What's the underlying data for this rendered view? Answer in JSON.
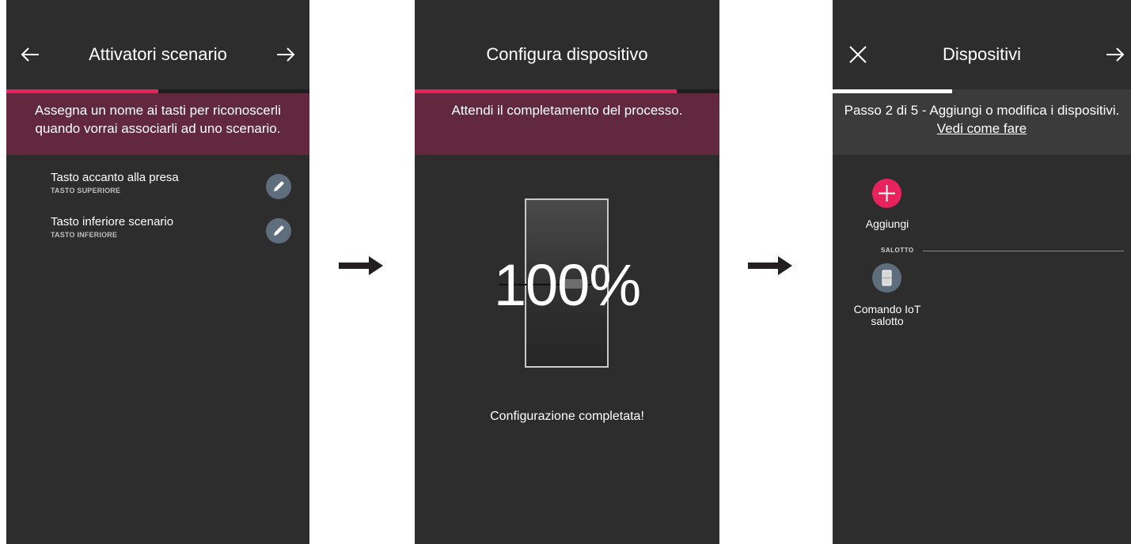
{
  "screen1": {
    "title": "Attivatori scenario",
    "progress_percent": 50,
    "banner": "Assegna un nome ai tasti per riconoscerli quando vorrai associarli ad uno scenario.",
    "buttons": [
      {
        "name": "Tasto accanto alla presa",
        "position": "TASTO SUPERIORE",
        "icon": "pencil-icon"
      },
      {
        "name": "Tasto inferiore scenario",
        "position": "TASTO INFERIORE",
        "icon": "pencil-icon"
      }
    ],
    "icons": {
      "back": "arrow-left-icon",
      "next": "arrow-right-icon"
    }
  },
  "screen2": {
    "title": "Configura dispositivo",
    "progress_percent": 86,
    "banner": "Attendi il completamento del processo.",
    "percent": "100%",
    "status": "Configurazione completata!"
  },
  "screen3": {
    "title": "Dispositivi",
    "progress_percent": 40,
    "banner_text": "Passo 2 di 5 - Aggiungi o modifica i dispositivi.",
    "banner_link": "Vedi come fare",
    "add_label": "Aggiungi",
    "section": "SALOTTO",
    "device_label": "Comando IoT salotto",
    "icons": {
      "close": "close-icon",
      "next": "arrow-right-icon",
      "add": "plus-icon",
      "device": "switch-icon"
    }
  },
  "colors": {
    "accent": "#e8225c",
    "background": "#2e2d2e",
    "banner": "#62293e",
    "icon_circle": "#5e6e7c"
  }
}
